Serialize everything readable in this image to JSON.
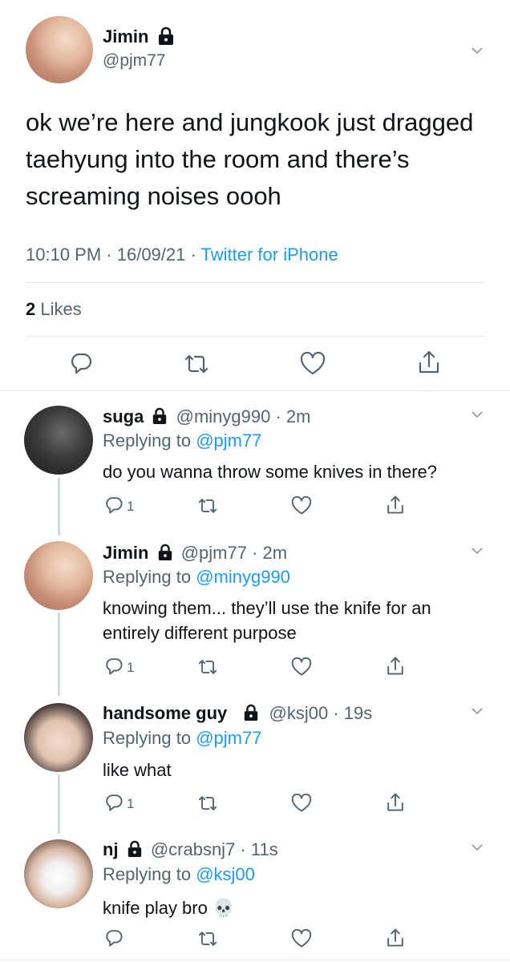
{
  "main_tweet": {
    "name": "Jimin",
    "handle": "@pjm77",
    "text": "ok we’re here and jungkook just dragged taehyung into the room and there’s screaming noises oooh",
    "time": "10:10 PM",
    "sep1": " · ",
    "date": "16/09/21",
    "sep2": " · ",
    "source": "Twitter for iPhone",
    "likes_count": "2",
    "likes_label": " Likes"
  },
  "replies": [
    {
      "name": "suga",
      "handle": "@minyg990",
      "time": "2m",
      "replying_label": "Replying to ",
      "replying_to": "@pjm77",
      "text": "do you wanna throw some knives in there?",
      "reply_count": "1"
    },
    {
      "name": "Jimin",
      "handle": "@pjm77",
      "time": "2m",
      "replying_label": "Replying to ",
      "replying_to": "@minyg990",
      "text": "knowing them... they’ll use the knife for an entirely different purpose",
      "reply_count": "1"
    },
    {
      "name": "handsome guy",
      "handle": "@ksj00",
      "time": "19s",
      "replying_label": "Replying to ",
      "replying_to": "@pjm77",
      "text": "like what",
      "reply_count": "1"
    },
    {
      "name": "nj",
      "handle": "@crabsnj7",
      "time": "11s",
      "replying_label": "Replying to ",
      "replying_to": "@ksj00",
      "text": "knife play bro 💀",
      "reply_count": ""
    }
  ],
  "dot": " · ",
  "icons": [
    "lock-icon",
    "chevron-down-icon",
    "reply-icon",
    "retweet-icon",
    "like-icon",
    "share-icon"
  ],
  "colors": {
    "link": "#1d9bf0",
    "muted": "#536471",
    "text": "#0f1419",
    "divider": "#e6e9eb"
  }
}
